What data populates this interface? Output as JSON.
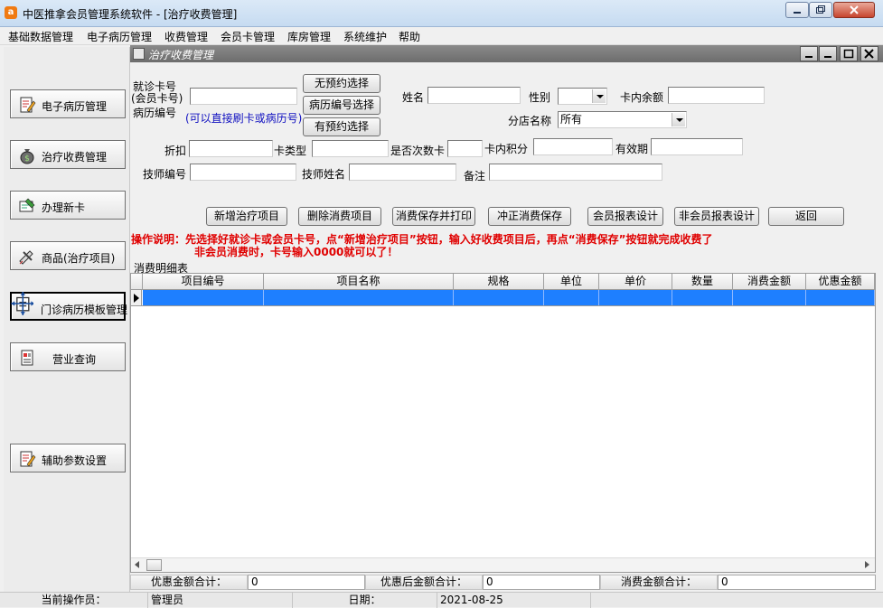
{
  "window": {
    "app_icon_letter": "a",
    "title": "中医推拿会员管理系统软件   - [治疗收费管理]"
  },
  "menu": [
    "基础数据管理",
    "电子病历管理",
    "收费管理",
    "会员卡管理",
    "库房管理",
    "系统维护",
    "帮助"
  ],
  "sidebar": [
    {
      "label": "电子病历管理"
    },
    {
      "label": "治疗收费管理"
    },
    {
      "label": "办理新卡"
    },
    {
      "label": "商品(治疗项目)"
    },
    {
      "label": "门诊病历模板管理"
    },
    {
      "label": "营业查询"
    },
    {
      "label": "辅助参数设置"
    }
  ],
  "child": {
    "title": "治疗收费管理"
  },
  "form": {
    "card_label_1": "就诊卡号",
    "card_label_2": "(会员卡号)",
    "card_label_3": "病历编号",
    "card_hint": "(可以直接刷卡或病历号)",
    "no_appt_btn": "无预约选择",
    "record_no_btn": "病历编号选择",
    "has_appt_btn": "有预约选择",
    "name_label": "姓名",
    "gender_label": "性别",
    "balance_label": "卡内余额",
    "branch_label": "分店名称",
    "branch_value": "所有",
    "discount_label": "折扣",
    "card_type_label": "卡类型",
    "times_card_label": "是否次数卡",
    "points_label": "卡内积分",
    "valid_label": "有效期",
    "tech_no_label": "技师编号",
    "tech_name_label": "技师姓名",
    "remark_label": "备注"
  },
  "actions": {
    "add_item": "新增治疗项目",
    "delete_item": "删除消费项目",
    "save_print": "消费保存并打印",
    "reverse_save": "冲正消费保存",
    "member_report": "会员报表设计",
    "nonmember_report": "非会员报表设计",
    "back": "返回"
  },
  "notice": {
    "line1": "操作说明：先选择好就诊卡或会员卡号，点“新增治疗项目”按钮，输入好收费项目后，再点“消费保存”按钮就完成收费了",
    "line2": "非会员消费时，卡号输入0000就可以了！"
  },
  "grid": {
    "caption": "消费明细表",
    "columns": [
      "项目编号",
      "项目名称",
      "规格",
      "单位",
      "单价",
      "数量",
      "消费金额",
      "优惠金额"
    ]
  },
  "totals": {
    "discount_total_label": "优惠金额合计：",
    "discount_total_value": "0",
    "after_discount_label": "优惠后金额合计：",
    "after_discount_value": "0",
    "consume_total_label": "消费金额合计：",
    "consume_total_value": "0"
  },
  "status": {
    "operator_label": "当前操作员：",
    "operator_value": "管理员",
    "date_label": "日期：",
    "date_value": "2021-08-25"
  },
  "colors": {
    "notice": "#e00000",
    "selection": "#1e7fff",
    "hint": "#1010c0"
  }
}
